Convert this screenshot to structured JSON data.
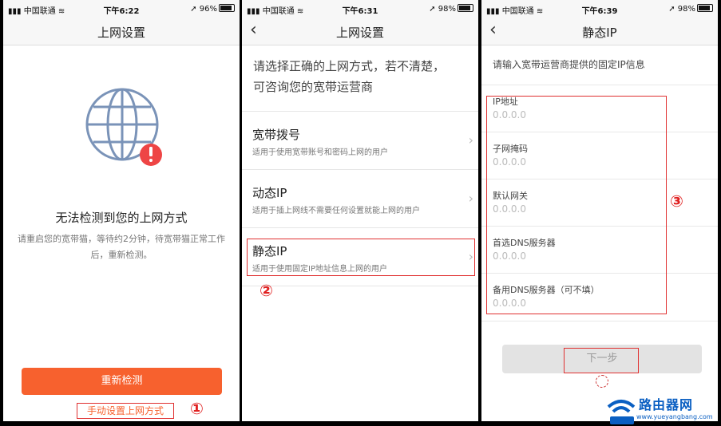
{
  "phone1": {
    "status": {
      "carrier": "中国联通",
      "time": "下午6:22",
      "battery": "96%"
    },
    "nav_title": "上网设置",
    "heading": "无法检测到您的上网方式",
    "desc_line1": "请重启您的宽带猫，等待约2分钟，待宽带猫正常工作",
    "desc_line2": "后，重新检测。",
    "retry_label": "重新检测",
    "manual_label": "手动设置上网方式",
    "marker": "①"
  },
  "phone2": {
    "status": {
      "carrier": "中国联通",
      "time": "下午6:31",
      "battery": "98%"
    },
    "nav_title": "上网设置",
    "intro_line1": "请选择正确的上网方式，若不清楚，",
    "intro_line2": "可咨询您的宽带运营商",
    "options": [
      {
        "title": "宽带拨号",
        "subtitle": "适用于使用宽带账号和密码上网的用户"
      },
      {
        "title": "动态IP",
        "subtitle": "适用于插上网线不需要任何设置就能上网的用户"
      },
      {
        "title": "静态IP",
        "subtitle": "适用于使用固定IP地址信息上网的用户"
      }
    ],
    "marker": "②"
  },
  "phone3": {
    "status": {
      "carrier": "中国联通",
      "time": "下午6:39",
      "battery": "98%"
    },
    "nav_title": "静态IP",
    "intro": "请输入宽带运营商提供的固定IP信息",
    "fields": [
      {
        "label": "IP地址",
        "placeholder": "0.0.0.0"
      },
      {
        "label": "子网掩码",
        "placeholder": "0.0.0.0"
      },
      {
        "label": "默认网关",
        "placeholder": "0.0.0.0"
      },
      {
        "label": "首选DNS服务器",
        "placeholder": "0.0.0.0"
      },
      {
        "label": "备用DNS服务器（可不填）",
        "placeholder": "0.0.0.0"
      }
    ],
    "next_label": "下一步",
    "marker": "③"
  },
  "watermark": {
    "text": "路由器网",
    "url": "www.yueyangbang.com"
  },
  "colors": {
    "accent": "#f7612e",
    "annotation": "#e03030",
    "watermark": "#0a5fc2"
  },
  "icons": {
    "signal": "signal-icon",
    "wifi": "wifi-icon",
    "globe": "globe-icon",
    "alert": "alert-icon",
    "back": "back-chevron-icon",
    "chevron": "chevron-right-icon"
  }
}
